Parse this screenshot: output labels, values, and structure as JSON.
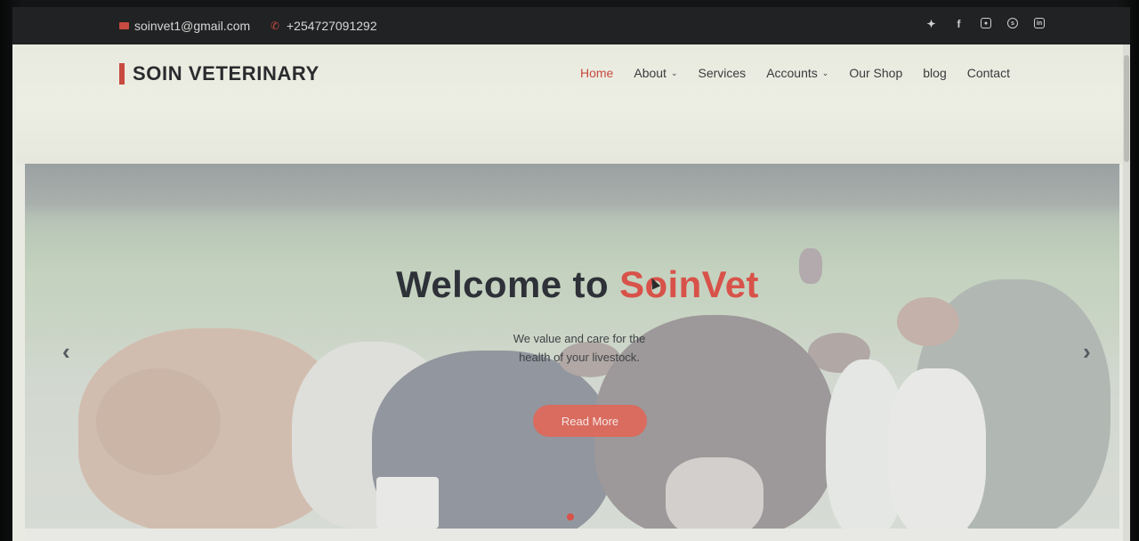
{
  "topbar": {
    "email": "soinvet1@gmail.com",
    "phone": "+254727091292",
    "social_icons": [
      "twitter-icon",
      "facebook-icon",
      "instagram-icon",
      "skype-icon",
      "linkedin-icon"
    ]
  },
  "navbar": {
    "brand": "SOIN VETERINARY",
    "menu": [
      {
        "label": "Home",
        "active": true
      },
      {
        "label": "About",
        "dropdown": true
      },
      {
        "label": "Services"
      },
      {
        "label": "Accounts",
        "dropdown": true
      },
      {
        "label": "Our Shop"
      },
      {
        "label": "blog"
      },
      {
        "label": "Contact"
      }
    ]
  },
  "hero": {
    "title_prefix": "Welcome to ",
    "title_accent": "SoinVet",
    "subtitle_line1": "We value and care for the",
    "subtitle_line2": "health of your livestock.",
    "button_label": "Read More"
  },
  "colors": {
    "accent": "#d8524a",
    "topbar_bg": "#212223",
    "text_dark": "#2e3138"
  }
}
